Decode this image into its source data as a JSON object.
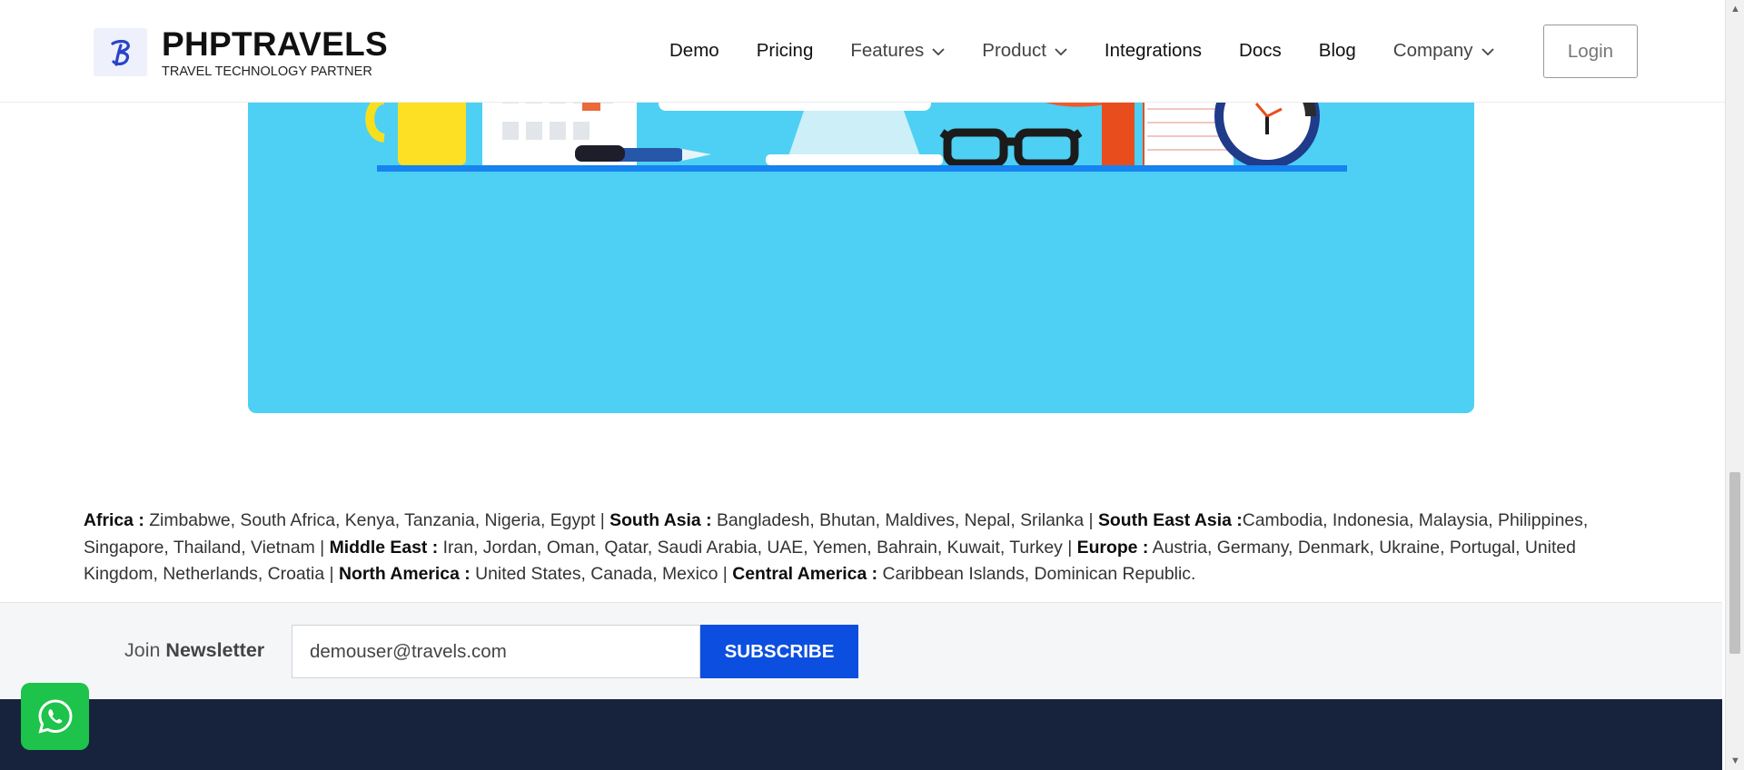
{
  "header": {
    "brand_name": "PHPTRAVELS",
    "brand_tagline": "TRAVEL TECHNOLOGY PARTNER",
    "logo_icon": "phptravels-logo-icon",
    "nav": [
      {
        "label": "Demo",
        "dropdown": false
      },
      {
        "label": "Pricing",
        "dropdown": false
      },
      {
        "label": "Features",
        "dropdown": true
      },
      {
        "label": "Product",
        "dropdown": true
      },
      {
        "label": "Integrations",
        "dropdown": false
      },
      {
        "label": "Docs",
        "dropdown": false
      },
      {
        "label": "Blog",
        "dropdown": false
      },
      {
        "label": "Company",
        "dropdown": true
      }
    ],
    "login_label": "Login"
  },
  "banner": {
    "background_color": "#4dd0f4"
  },
  "regions": [
    {
      "name": "Africa :",
      "countries": " Zimbabwe, South Africa, Kenya, Tanzania, Nigeria, Egypt | "
    },
    {
      "name": "South Asia :",
      "countries": " Bangladesh, Bhutan, Maldives, Nepal, Srilanka | "
    },
    {
      "name": "South East Asia :",
      "countries": "Cambodia, Indonesia, Malaysia, Philippines, Singapore, Thailand, Vietnam | "
    },
    {
      "name": "Middle East :",
      "countries": " Iran, Jordan, Oman, Qatar, Saudi Arabia, UAE, Yemen, Bahrain, Kuwait, Turkey | "
    },
    {
      "name": "Europe :",
      "countries": " Austria, Germany, Denmark, Ukraine, Portugal, United Kingdom, Netherlands, Croatia | "
    },
    {
      "name": "North America :",
      "countries": " United States, Canada, Mexico | "
    },
    {
      "name": "Central America :",
      "countries": " Caribbean Islands, Dominican Republic."
    }
  ],
  "newsletter": {
    "label_prefix": "Join ",
    "label_strong": "Newsletter",
    "email_value": "demouser@travels.com",
    "subscribe_label": "SUBSCRIBE"
  },
  "colors": {
    "accent_blue": "#0c4fe0",
    "footer_navy": "#17233d",
    "whatsapp_green": "#1dc34a"
  }
}
